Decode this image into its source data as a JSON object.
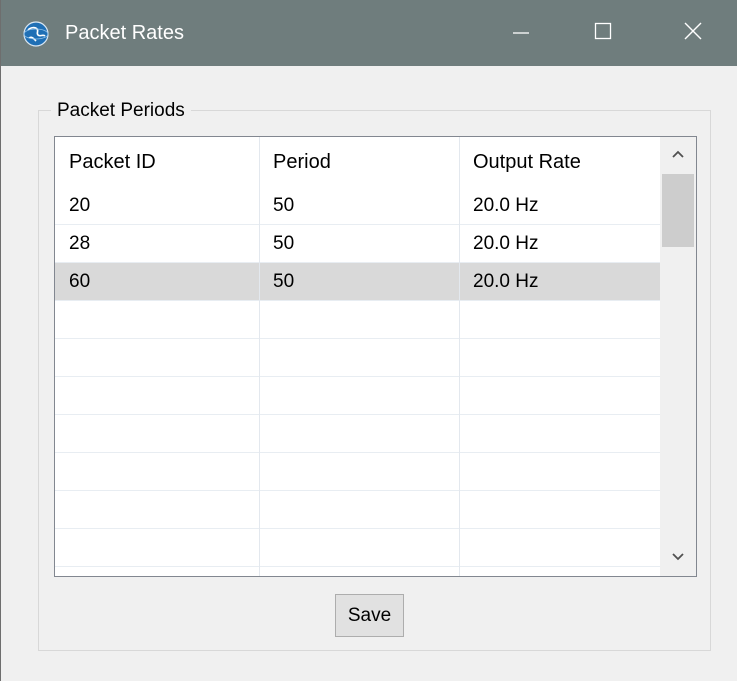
{
  "window": {
    "title": "Packet Rates",
    "icon": "app-globe-icon",
    "controls": {
      "minimize": "minimize-icon",
      "maximize": "maximize-icon",
      "close": "close-icon"
    },
    "colors": {
      "titlebar": "#6f7d7d",
      "background": "#f0f0f0",
      "selected_row": "#d9d9d9"
    }
  },
  "group": {
    "label": "Packet Periods"
  },
  "table": {
    "columns": [
      "Packet ID",
      "Period",
      "Output Rate"
    ],
    "rows": [
      [
        "20",
        "50",
        "20.0 Hz"
      ],
      [
        "28",
        "50",
        "20.0 Hz"
      ],
      [
        "60",
        "50",
        "20.0 Hz"
      ]
    ],
    "selected_row": 2,
    "empty_rows": 7
  },
  "actions": {
    "save_label": "Save"
  }
}
